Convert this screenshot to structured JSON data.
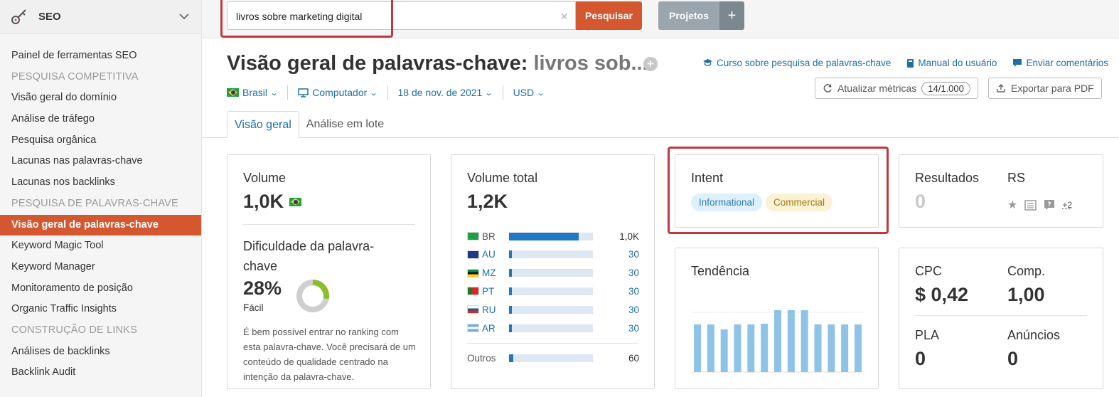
{
  "sidebar": {
    "header": "SEO",
    "items": [
      {
        "type": "item",
        "label": "Painel de ferramentas SEO"
      },
      {
        "type": "section",
        "label": "PESQUISA COMPETITIVA"
      },
      {
        "type": "item",
        "label": "Visão geral do domínio"
      },
      {
        "type": "item",
        "label": "Análise de tráfego"
      },
      {
        "type": "item",
        "label": "Pesquisa orgânica"
      },
      {
        "type": "item",
        "label": "Lacunas nas palavras-chave"
      },
      {
        "type": "item",
        "label": "Lacunas nos backlinks"
      },
      {
        "type": "section",
        "label": "PESQUISA DE PALAVRAS-CHAVE"
      },
      {
        "type": "item",
        "label": "Visão geral de palavras-chave",
        "active": true
      },
      {
        "type": "item",
        "label": "Keyword Magic Tool"
      },
      {
        "type": "item",
        "label": "Keyword Manager"
      },
      {
        "type": "item",
        "label": "Monitoramento de posição"
      },
      {
        "type": "item",
        "label": "Organic Traffic Insights"
      },
      {
        "type": "section",
        "label": "CONSTRUÇÃO DE LINKS"
      },
      {
        "type": "item",
        "label": "Análises de backlinks"
      },
      {
        "type": "item",
        "label": "Backlink Audit"
      }
    ]
  },
  "topbar": {
    "search_value": "livros sobre marketing digital",
    "search_clear": "×",
    "search_button": "Pesquisar",
    "projects_button": "Projetos",
    "projects_plus": "+"
  },
  "header": {
    "title": "Visão geral de palavras-chave:",
    "keyword": "livros sob...",
    "links": [
      {
        "icon": "graduation-cap-icon",
        "label": "Curso sobre pesquisa de palavras-chave"
      },
      {
        "icon": "book-icon",
        "label": "Manual do usuário"
      },
      {
        "icon": "chat-bubble-icon",
        "label": "Enviar comentários"
      }
    ],
    "filters": {
      "country": "Brasil",
      "device": "Computador",
      "date": "18 de nov. de 2021",
      "currency": "USD"
    },
    "update_metrics": "Atualizar métricas",
    "update_count": "14/1.000",
    "export_pdf": "Exportar para PDF"
  },
  "tabs": [
    "Visão geral",
    "Análise em lote"
  ],
  "volume_card": {
    "title": "Volume",
    "value": "1,0K",
    "difficulty_title": "Dificuldade da palavra-chave",
    "difficulty_value": "28%",
    "difficulty_percent": 28,
    "difficulty_label": "Fácil",
    "difficulty_desc": "É bem possível entrar no ranking com esta palavra-chave. Você precisará de um conteúdo de qualidade centrado na intenção da palavra-chave."
  },
  "total_volume_card": {
    "title": "Volume total",
    "value": "1,2K",
    "countries": [
      {
        "code": "BR",
        "value": "1,0K",
        "fraction": 0.83
      },
      {
        "code": "AU",
        "value": "30",
        "fraction": 0.03
      },
      {
        "code": "MZ",
        "value": "30",
        "fraction": 0.03
      },
      {
        "code": "PT",
        "value": "30",
        "fraction": 0.03
      },
      {
        "code": "RU",
        "value": "30",
        "fraction": 0.03
      },
      {
        "code": "AR",
        "value": "30",
        "fraction": 0.03
      }
    ],
    "others_label": "Outros",
    "others_value": "60",
    "others_fraction": 0.05
  },
  "intent_card": {
    "title": "Intent",
    "tags": [
      "Informational",
      "Commercial"
    ]
  },
  "results_card": {
    "results_title": "Resultados",
    "results_value": "0",
    "rs_title": "RS",
    "rs_more": "+2"
  },
  "trend_card": {
    "title": "Tendência",
    "values": [
      0.67,
      0.67,
      0.6,
      0.67,
      0.67,
      0.68,
      0.87,
      0.87,
      0.87,
      0.67,
      0.67,
      0.67,
      0.67
    ]
  },
  "cpc_card": {
    "cpc_title": "CPC",
    "cpc_value": "$ 0,42",
    "comp_title": "Comp.",
    "comp_value": "1,00",
    "pla_title": "PLA",
    "pla_value": "0",
    "ads_title": "Anúncios",
    "ads_value": "0"
  }
}
